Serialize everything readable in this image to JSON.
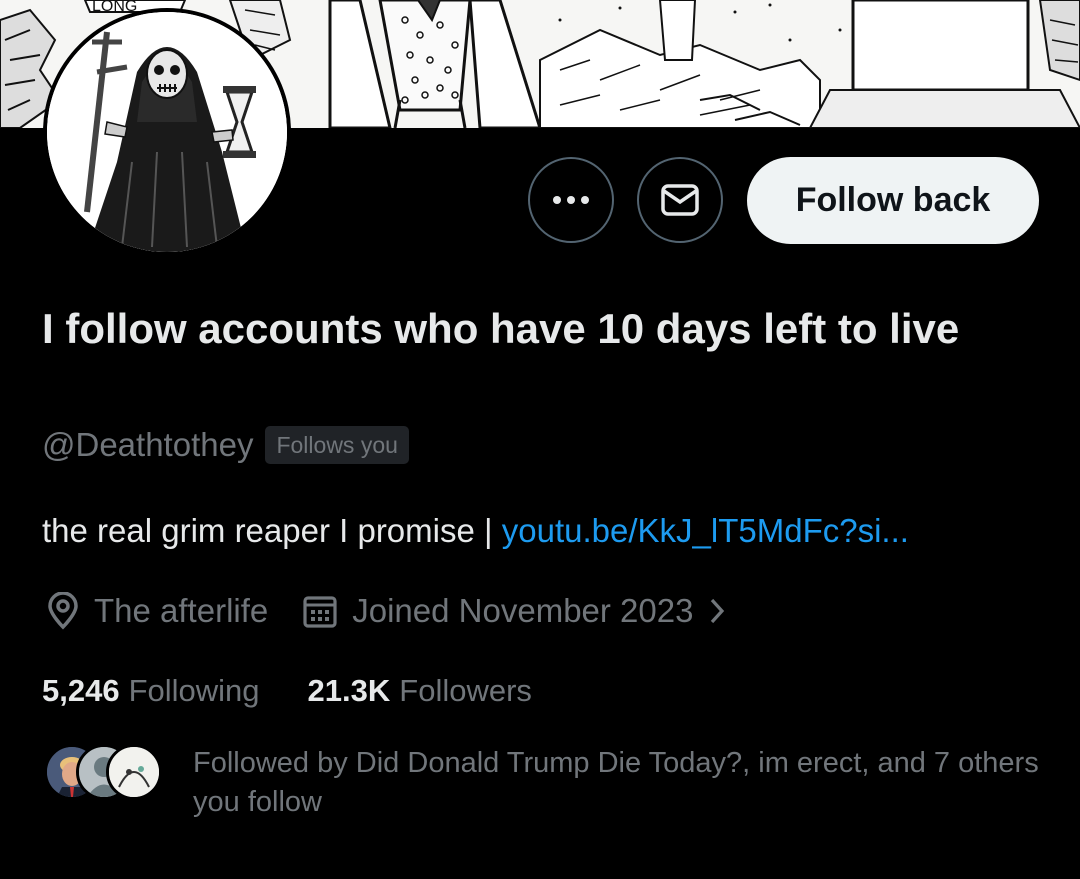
{
  "banner": {
    "sign_text": "LONG"
  },
  "profile": {
    "display_name": "I follow accounts who have 10 days left to live",
    "handle": "@Deathtothey",
    "follows_you_badge": "Follows you",
    "bio_text": "the real grim reaper I promise | ",
    "bio_link": "youtu.be/KkJ_lT5MdFc?si...",
    "location": "The afterlife",
    "joined": "Joined November 2023"
  },
  "actions": {
    "more_icon": "more-horizontal-icon",
    "message_icon": "envelope-icon",
    "follow_label": "Follow back"
  },
  "stats": {
    "following_count": "5,246",
    "following_label": "Following",
    "followers_count": "21.3K",
    "followers_label": "Followers"
  },
  "followed_by": {
    "text": "Followed by Did Donald Trump Die Today?, im erect, and 7 others you follow"
  },
  "colors": {
    "background": "#000000",
    "primary_text": "#e7e9ea",
    "secondary_text": "#71767b",
    "link": "#1d9bf0",
    "button_bg": "#eff3f4",
    "border": "#536471"
  }
}
